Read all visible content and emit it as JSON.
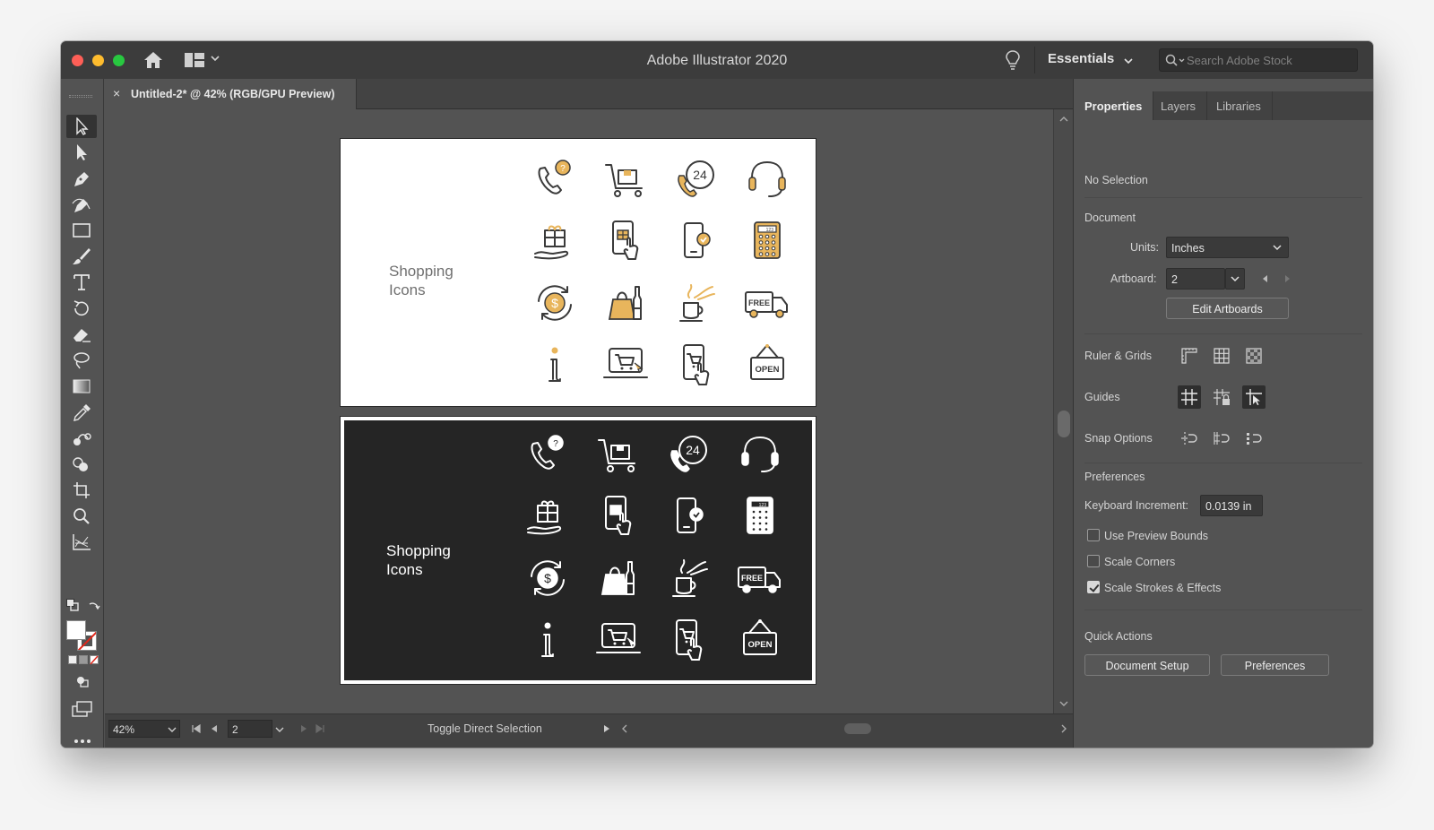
{
  "window": {
    "title": "Adobe Illustrator 2020",
    "workspace": "Essentials",
    "search_placeholder": "Search Adobe Stock"
  },
  "document_tab": {
    "close_glyph": "×",
    "label": "Untitled-2* @ 42% (RGB/GPU Preview)"
  },
  "tools": [
    "selection-tool",
    "direct-selection-tool",
    "pen-tool",
    "curvature-tool",
    "rectangle-tool",
    "paintbrush-tool",
    "type-tool",
    "rotate-tool",
    "eraser-tool",
    "lasso-tool",
    "gradient-tool",
    "eyedropper-tool",
    "blend-tool",
    "shape-builder-tool",
    "artboard-tool",
    "zoom-tool",
    "graph-tool"
  ],
  "artboards": {
    "light": {
      "title": "Shopping\nIcons",
      "accent": "#e8b55c",
      "stroke": "#3a3a3a"
    },
    "dark": {
      "title": "Shopping\nIcons",
      "accent": "#ffffff",
      "stroke": "#ffffff"
    },
    "icons": [
      [
        "phone-question-icon",
        "shopping-cart-box-icon",
        "phone-24h-icon",
        "headset-icon"
      ],
      [
        "gift-hand-icon",
        "tablet-gift-touch-icon",
        "mobile-check-icon",
        "calculator-icon"
      ],
      [
        "dollar-refresh-icon",
        "shopping-bag-bottle-icon",
        "coffee-cup-icon",
        "free-delivery-truck-icon"
      ],
      [
        "info-icon",
        "laptop-cart-icon",
        "mobile-cart-touch-icon",
        "open-sign-icon"
      ]
    ],
    "icon_text": {
      "calc": "123",
      "free": "FREE",
      "open": "OPEN",
      "phone24": "24",
      "dollar": "$"
    }
  },
  "statusbar": {
    "zoom": "42%",
    "artboard": "2",
    "status": "Toggle Direct Selection"
  },
  "panel": {
    "tabs": [
      "Properties",
      "Layers",
      "Libraries"
    ],
    "selection": "No Selection",
    "document_heading": "Document",
    "units_label": "Units:",
    "units_value": "Inches",
    "artboard_label": "Artboard:",
    "artboard_value": "2",
    "edit_artboards": "Edit Artboards",
    "ruler_grids": "Ruler & Grids",
    "guides": "Guides",
    "snap_options": "Snap Options",
    "preferences_heading": "Preferences",
    "keyboard_increment_label": "Keyboard Increment:",
    "keyboard_increment_value": "0.0139 in",
    "checkboxes": [
      {
        "label": "Use Preview Bounds",
        "checked": false
      },
      {
        "label": "Scale Corners",
        "checked": false
      },
      {
        "label": "Scale Strokes & Effects",
        "checked": true
      }
    ],
    "quick_actions": "Quick Actions",
    "document_setup": "Document Setup",
    "preferences_btn": "Preferences"
  }
}
